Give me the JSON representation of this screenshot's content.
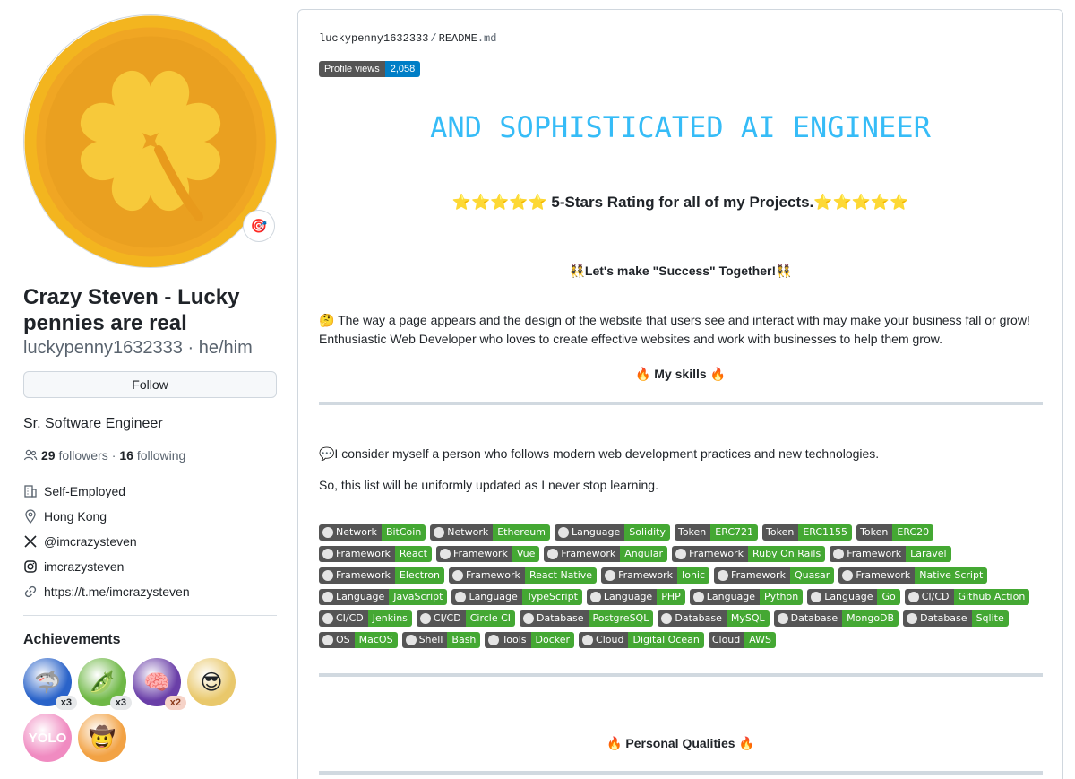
{
  "profile": {
    "full_name": "Crazy Steven - Lucky pennies are real",
    "username": "luckypenny1632333",
    "pronouns": "he/him",
    "status_emoji": "🎯",
    "follow_label": "Follow",
    "bio": "Sr. Software Engineer",
    "followers_count": "29",
    "followers_label": "followers",
    "following_count": "16",
    "following_label": "following",
    "company": "Self-Employed",
    "location": "Hong Kong",
    "x_handle": "@imcrazysteven",
    "instagram": "imcrazysteven",
    "website": "https://t.me/imcrazysteven"
  },
  "achievements": {
    "title": "Achievements",
    "items": [
      {
        "name": "shark",
        "emoji": "🦈",
        "count": "x3",
        "bg": "#2a63c9"
      },
      {
        "name": "pair",
        "emoji": "🫛",
        "count": "x3",
        "bg": "#6fb846"
      },
      {
        "name": "galaxy-brain",
        "emoji": "🧠",
        "count": "x2",
        "bg": "#6a3fa8"
      },
      {
        "name": "quickdraw",
        "emoji": "😎",
        "count": "",
        "bg": "#e9c86b"
      },
      {
        "name": "yolo",
        "emoji": "YOLO",
        "count": "",
        "bg": "#f08bc1"
      },
      {
        "name": "starstruck",
        "emoji": "🤠",
        "count": "",
        "bg": "#f2a244"
      }
    ]
  },
  "readme": {
    "owner": "luckypenny1632333",
    "file": "README",
    "ext": ".md",
    "views_label": "Profile views",
    "views_count": "2,058",
    "typing_text": "AND SOPHISTICATED AI ENGINEER",
    "stars": "⭐⭐⭐⭐⭐",
    "rating_text": " 5-Stars Rating for all of my Projects.",
    "together_text": "👯Let's make \"Success\" Together!👯",
    "intro_line1": "🤔 The way a page appears and the design of the website that users see and interact with may make your business fall or grow!",
    "intro_line2": "Enthusiastic Web Developer who loves to create effective websites and work with businesses to help them grow.",
    "skills_heading": "🔥 My skills 🔥",
    "consider_text": "💬I consider myself a person who follows modern web development practices and new technologies.",
    "updated_text": "So, this list will be uniformly updated as I never stop learning.",
    "qualities_heading": "🔥 Personal Qualities 🔥"
  },
  "badges": [
    {
      "label": "Network",
      "value": "BitCoin"
    },
    {
      "label": "Network",
      "value": "Ethereum"
    },
    {
      "label": "Language",
      "value": "Solidity"
    },
    {
      "label": "Token",
      "value": "ERC721",
      "noicon": true
    },
    {
      "label": "Token",
      "value": "ERC1155",
      "noicon": true
    },
    {
      "label": "Token",
      "value": "ERC20",
      "noicon": true
    },
    {
      "label": "Framework",
      "value": "React"
    },
    {
      "label": "Framework",
      "value": "Vue"
    },
    {
      "label": "Framework",
      "value": "Angular"
    },
    {
      "label": "Framework",
      "value": "Ruby On Rails"
    },
    {
      "label": "Framework",
      "value": "Laravel"
    },
    {
      "label": "Framework",
      "value": "Electron"
    },
    {
      "label": "Framework",
      "value": "React Native"
    },
    {
      "label": "Framework",
      "value": "Ionic"
    },
    {
      "label": "Framework",
      "value": "Quasar"
    },
    {
      "label": "Framework",
      "value": "Native Script"
    },
    {
      "label": "Language",
      "value": "JavaScript"
    },
    {
      "label": "Language",
      "value": "TypeScript"
    },
    {
      "label": "Language",
      "value": "PHP"
    },
    {
      "label": "Language",
      "value": "Python"
    },
    {
      "label": "Language",
      "value": "Go"
    },
    {
      "label": "CI/CD",
      "value": "Github Action"
    },
    {
      "label": "CI/CD",
      "value": "Jenkins"
    },
    {
      "label": "CI/CD",
      "value": "Circle CI"
    },
    {
      "label": "Database",
      "value": "PostgreSQL"
    },
    {
      "label": "Database",
      "value": "MySQL"
    },
    {
      "label": "Database",
      "value": "MongoDB"
    },
    {
      "label": "Database",
      "value": "Sqlite"
    },
    {
      "label": "OS",
      "value": "MacOS"
    },
    {
      "label": "Shell",
      "value": "Bash"
    },
    {
      "label": "Tools",
      "value": "Docker"
    },
    {
      "label": "Cloud",
      "value": "Digital Ocean"
    },
    {
      "label": "Cloud",
      "value": "AWS",
      "noicon": true
    }
  ]
}
